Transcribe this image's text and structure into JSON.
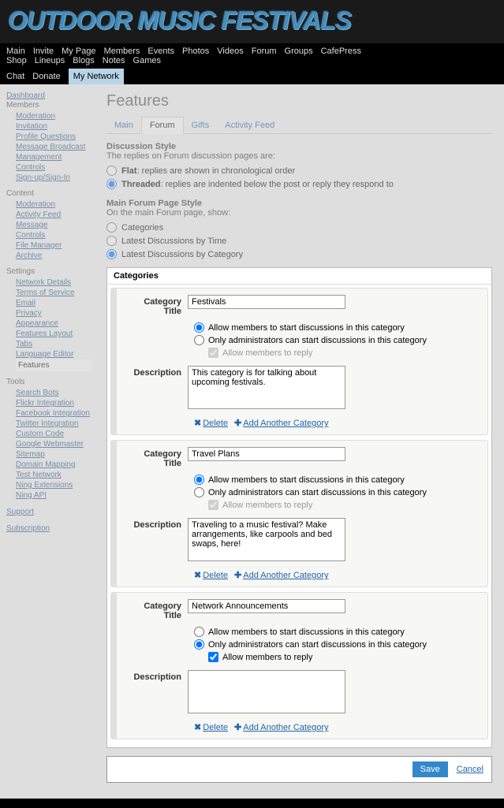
{
  "logo": "OUTDOOR MUSIC FESTIVALS",
  "nav1": [
    "Main",
    "Invite",
    "My Page",
    "Members",
    "Events",
    "Photos",
    "Videos",
    "Forum",
    "Groups",
    "CafePress Shop",
    "Lineups",
    "Blogs",
    "Notes",
    "Games"
  ],
  "nav2": [
    "Chat",
    "Donate",
    "My Network"
  ],
  "nav2_active": 2,
  "sidebar": {
    "top": "Dashboard",
    "groups": [
      {
        "title": "Members",
        "items": [
          "Moderation",
          "Invitation",
          "Profile Questions",
          "Message Broadcast",
          "Management",
          "Controls",
          "Sign-up/Sign-In"
        ]
      },
      {
        "title": "Content",
        "items": [
          "Moderation",
          "Activity Feed Message",
          "Controls",
          "File Manager",
          "Archive"
        ]
      },
      {
        "title": "Settings",
        "items": [
          "Network Details",
          "Terms of Service",
          "Email",
          "Privacy",
          "Appearance",
          "Features Layout",
          "Tabs",
          "Language Editor",
          "Features"
        ],
        "active": 8
      },
      {
        "title": "Tools",
        "items": [
          "Search Bots",
          "Flickr Integration",
          "Facebook Integration",
          "Twitter Integration",
          "Custom Code",
          "Google Webmaster",
          "Sitemap",
          "Domain Mapping",
          "Test Network",
          "Ning Extensions",
          "Ning API"
        ]
      }
    ],
    "support": "Support",
    "subscription": "Subscription"
  },
  "page_title": "Features",
  "tabs": [
    "Main",
    "Forum",
    "Gifts",
    "Activity Feed"
  ],
  "tabs_active": 1,
  "discussion_style": {
    "title": "Discussion Style",
    "desc": "The replies on Forum discussion pages are:",
    "flat_label": "Flat",
    "flat_desc": ": replies are shown in chronological order",
    "threaded_label": "Threaded",
    "threaded_desc": ": replies are indented below the post or reply they respond to"
  },
  "forum_page_style": {
    "title": "Main Forum Page Style",
    "desc": "On the main Forum page, show:",
    "opts": [
      "Categories",
      "Latest Discussions by Time",
      "Latest Discussions by Category"
    ]
  },
  "categories_label": "Categories",
  "field_labels": {
    "title": "Category Title",
    "desc": "Description"
  },
  "cat_options": {
    "allow_members": "Allow members to start discussions in this category",
    "only_admins": "Only administrators can start discussions in this category",
    "allow_reply": "Allow members to reply"
  },
  "actions": {
    "delete": "Delete",
    "add": "Add Another Category"
  },
  "categories": [
    {
      "title": "Festivals",
      "perm": 0,
      "reply": true,
      "reply_enabled": false,
      "desc": "This category is for talking about upcoming festivals."
    },
    {
      "title": "Travel Plans",
      "perm": 0,
      "reply": true,
      "reply_enabled": false,
      "desc": "Traveling to a music festival? Make arrangements, like carpools and bed swaps, here!"
    },
    {
      "title": "Network Announcements",
      "perm": 1,
      "reply": true,
      "reply_enabled": true,
      "desc": ""
    }
  ],
  "buttons": {
    "save": "Save",
    "cancel": "Cancel"
  }
}
